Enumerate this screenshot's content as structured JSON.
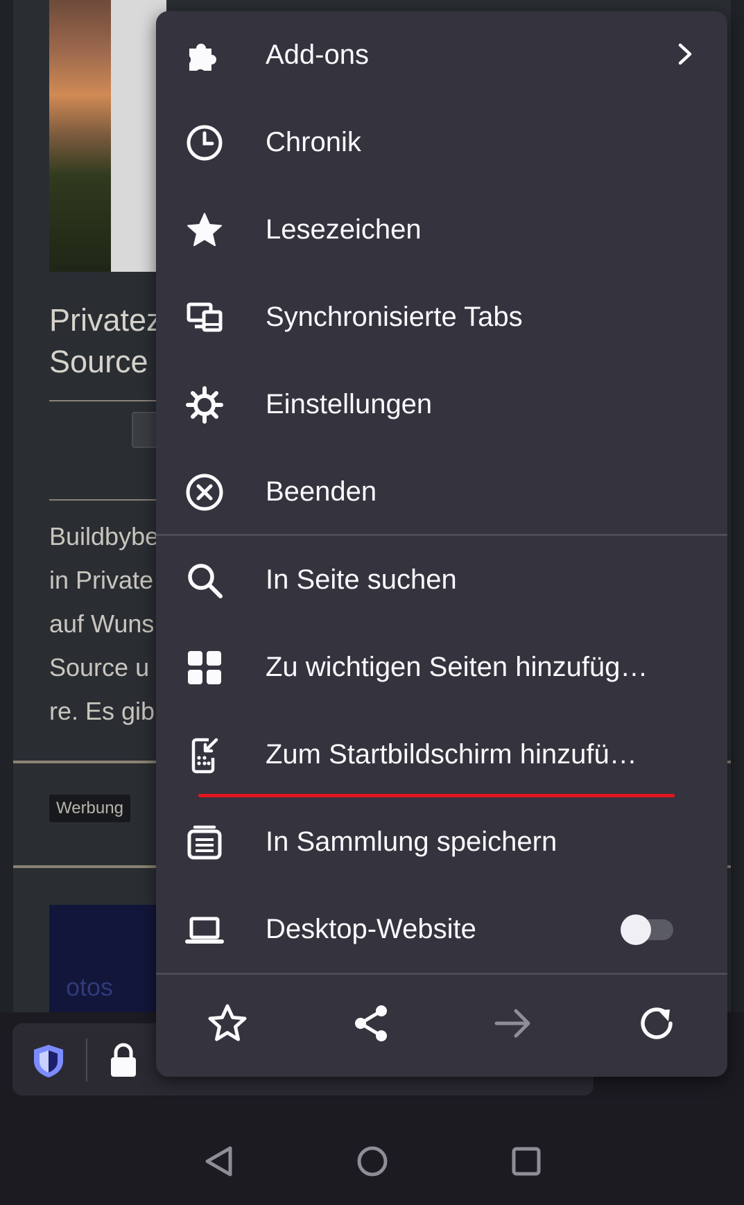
{
  "article": {
    "title": "Privatez\nSource",
    "body": "Buildbybe\nin Private\nauf  Wuns\nSource u\nre. Es gib",
    "ad_label": "Werbung",
    "promo_text": "otos"
  },
  "menu": {
    "items": [
      {
        "label": "Add-ons",
        "icon": "puzzle-icon"
      },
      {
        "label": "Chronik",
        "icon": "clock-icon"
      },
      {
        "label": "Lesezeichen",
        "icon": "star-filled-icon"
      },
      {
        "label": "Synchronisierte Tabs",
        "icon": "synced-devices-icon"
      },
      {
        "label": "Einstellungen",
        "icon": "gear-icon"
      },
      {
        "label": "Beenden",
        "icon": "close-circle-icon"
      },
      {
        "label": "In Seite suchen",
        "icon": "search-icon"
      },
      {
        "label": "Zu wichtigen Seiten hinzufüg…",
        "icon": "grid-icon"
      },
      {
        "label": "Zum Startbildschirm hinzufü…",
        "icon": "add-to-homescreen-icon"
      },
      {
        "label": "In Sammlung speichern",
        "icon": "collection-icon"
      },
      {
        "label": "Desktop-Website",
        "icon": "laptop-icon"
      }
    ],
    "desktop_site_enabled": false,
    "bottom_actions": [
      "bookmark-icon",
      "share-icon",
      "forward-icon",
      "reload-icon"
    ]
  },
  "colors": {
    "menu_bg": "#34333e",
    "highlight": "#e0161d",
    "shield_accent": "#7c8cff"
  }
}
